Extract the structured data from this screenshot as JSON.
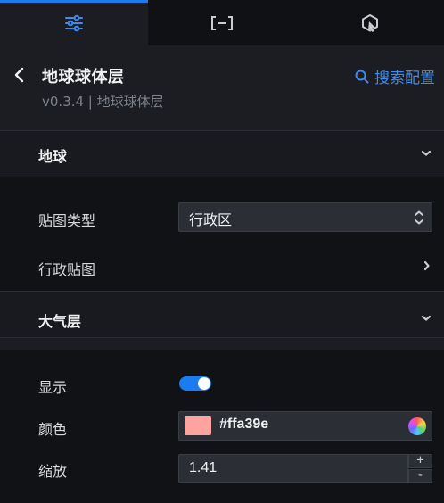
{
  "tabs": [
    {
      "name": "style-config",
      "icon": "sliders-icon",
      "active": true
    },
    {
      "name": "data-config",
      "icon": "bracket-icon",
      "active": false
    },
    {
      "name": "interaction-config",
      "icon": "interaction-icon",
      "active": false
    }
  ],
  "header": {
    "title": "地球球体层",
    "version": "v0.3.4 | 地球球体层",
    "search_label": "搜索配置"
  },
  "sections": {
    "earth": {
      "title": "地球",
      "texture_type_label": "贴图类型",
      "texture_type_value": "行政区",
      "admin_texture_label": "行政贴图"
    },
    "atmosphere": {
      "title": "大气层",
      "show_label": "显示",
      "show_enabled": true,
      "color_label": "颜色",
      "color_value": "#ffa39e",
      "scale_label": "缩放",
      "scale_value": "1.41"
    }
  },
  "colors": {
    "accent": "#1b7bf0",
    "link": "#3b8cf0",
    "swatch": "#ffa39e"
  }
}
